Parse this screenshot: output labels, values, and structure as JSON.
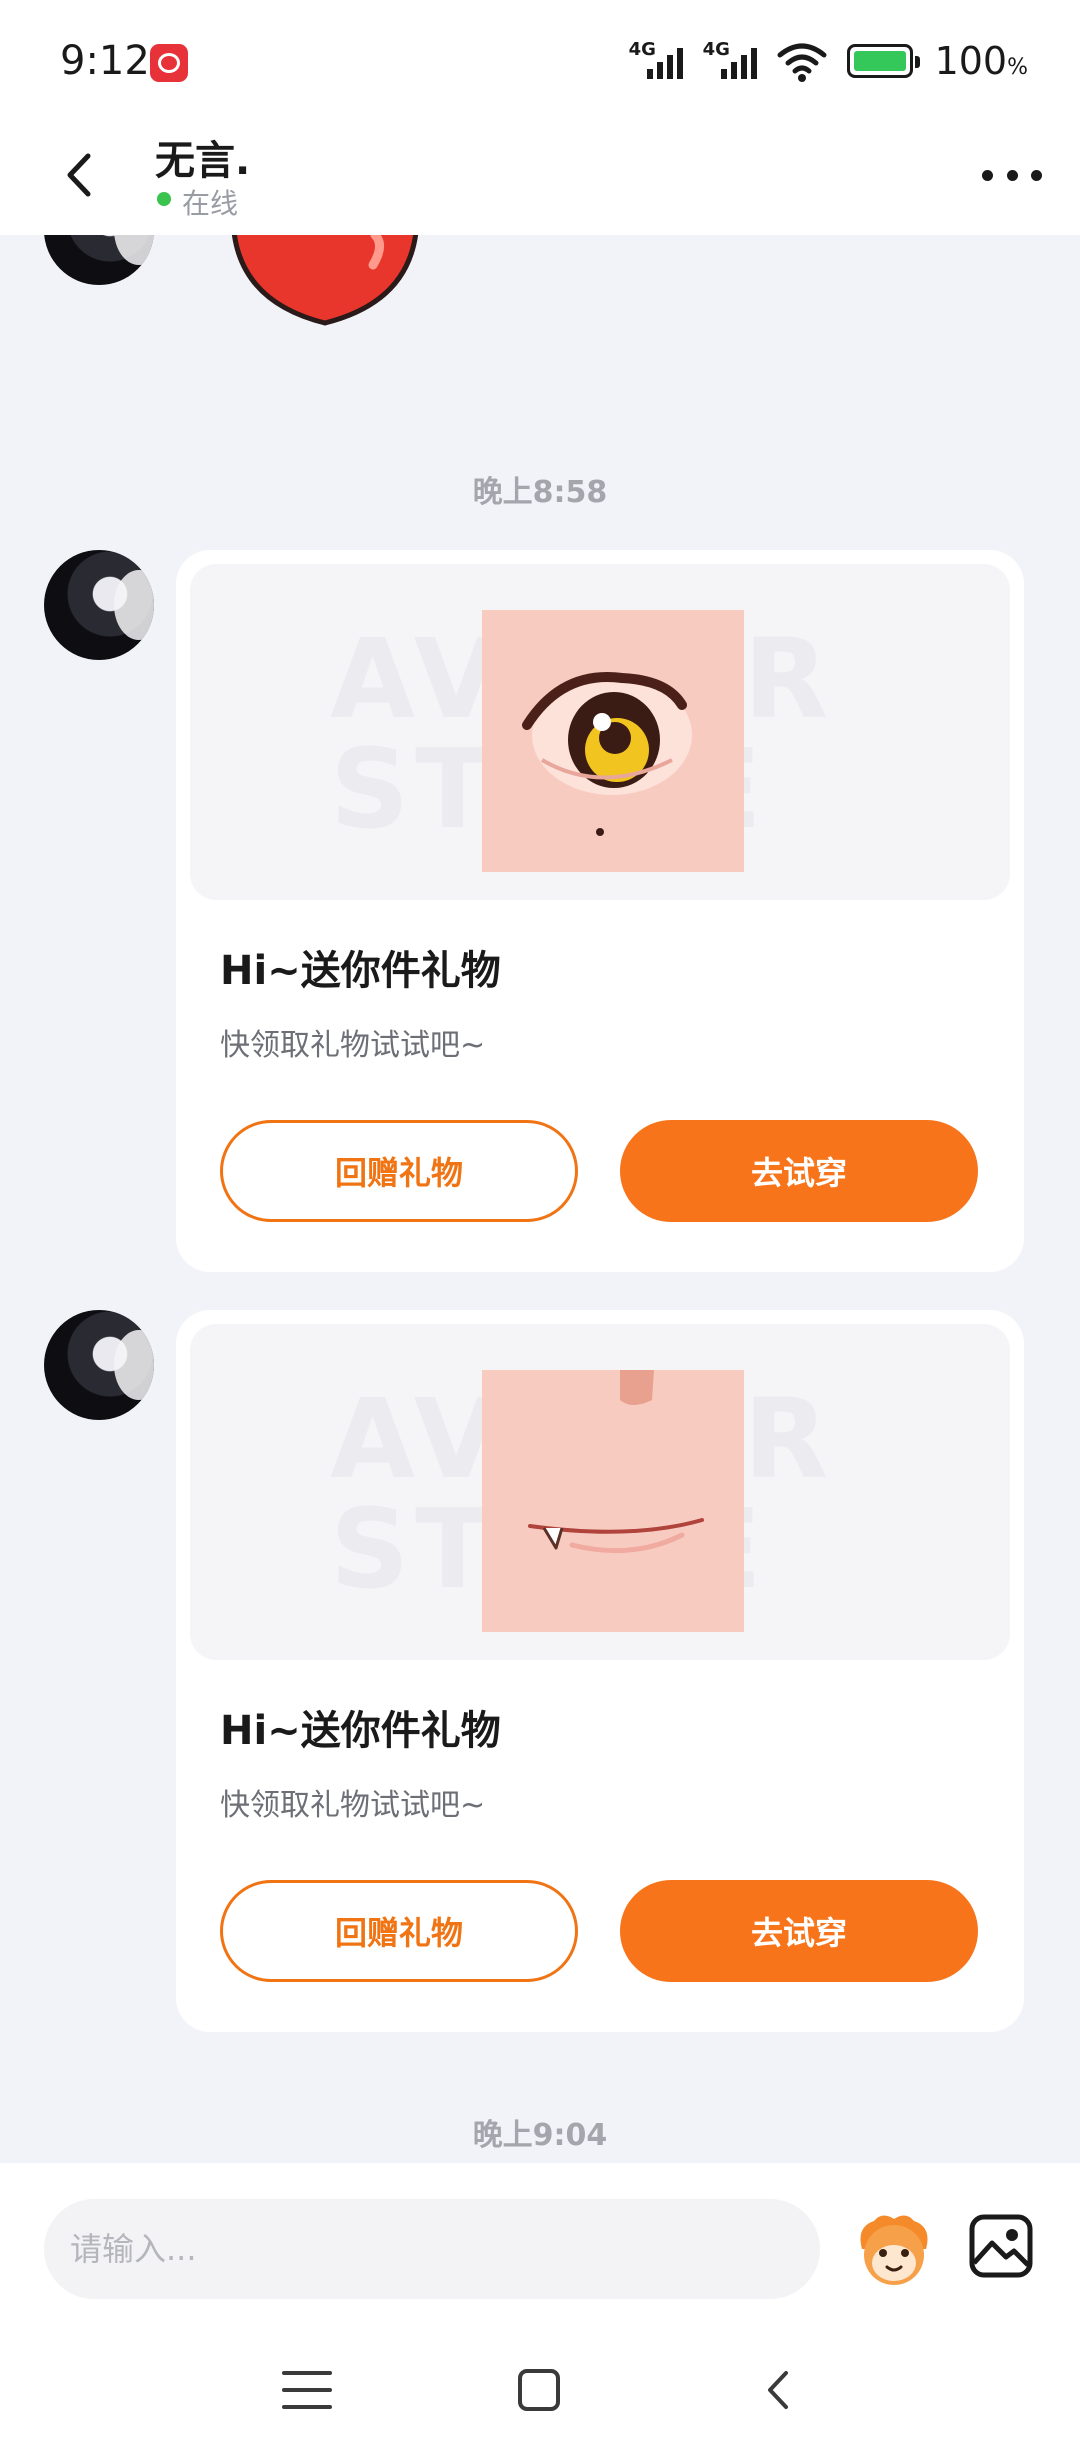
{
  "status_bar": {
    "time": "9:12",
    "network_1": "4G",
    "network_2": "4G",
    "battery_level": "100",
    "battery_unit": "%"
  },
  "header": {
    "contact_name": "无言.",
    "status_text": "在线"
  },
  "chat": {
    "messages": [
      {
        "type": "time",
        "text": "晚上8:58"
      },
      {
        "type": "gift_card",
        "watermark": "AVATAR STORE",
        "title": "Hi~送你件礼物",
        "subtitle": "快领取礼物试试吧~",
        "return_gift_label": "回赠礼物",
        "try_on_label": "去试穿"
      },
      {
        "type": "gift_card",
        "watermark": "AVATAR STORE",
        "title": "Hi~送你件礼物",
        "subtitle": "快领取礼物试试吧~",
        "return_gift_label": "回赠礼物",
        "try_on_label": "去试穿"
      },
      {
        "type": "time",
        "text": "晚上9:04"
      }
    ]
  },
  "composer": {
    "placeholder": "请输入..."
  },
  "colors": {
    "accent": "#f7741a",
    "online": "#3ac34f",
    "background": "#f2f3f8"
  },
  "icons": [
    "back-arrow-icon",
    "more-icon",
    "emoji-icon",
    "image-icon",
    "menu-icon",
    "home-icon",
    "nav-back-icon"
  ]
}
